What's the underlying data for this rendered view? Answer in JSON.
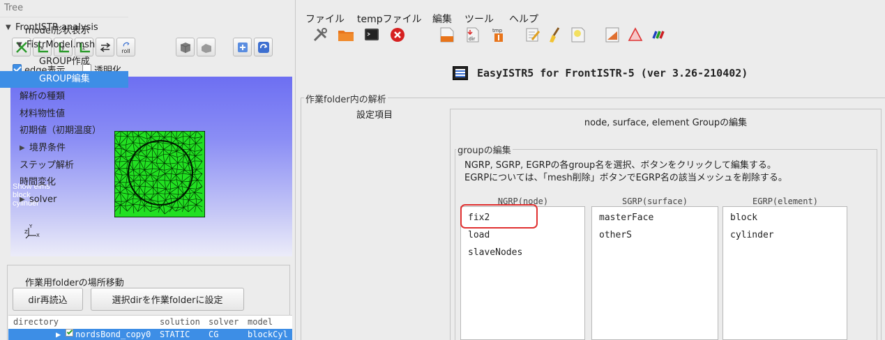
{
  "left": {
    "model_view_title": "model形状表示",
    "toolbar": {
      "roll_label": "roll",
      "x_label": "x",
      "y_label": "y",
      "z_label": "z"
    },
    "edge_display": {
      "label": "edge表示",
      "checked": true
    },
    "transparent": {
      "label": "透明化",
      "checked": false
    },
    "overlay": {
      "line1": "Show elms",
      "line2": "block",
      "line3": "cylinder"
    },
    "axes": {
      "y": "Y",
      "z": "Z",
      "x": "X"
    },
    "workdir": {
      "title": "作業用folderの場所移動",
      "reload_button": "dir再読込",
      "set_button": "選択dirを作業folderに設定"
    },
    "table": {
      "headers": [
        "directory",
        "solution",
        "solver",
        "model"
      ],
      "row": {
        "directory": "nordsBond_copy0",
        "solution": "STATIC",
        "solver": "CG",
        "model": "blockCyl"
      }
    }
  },
  "menu": [
    "ファイル",
    "tempファイル",
    "編集",
    "ツール",
    "ヘルプ"
  ],
  "toolbar_icons": [
    "tools-icon",
    "folder-icon",
    "terminal-icon",
    "close-icon",
    "file-icon",
    "dir-icon",
    "tmp-icon",
    "edit-icon",
    "brush-icon",
    "note-icon",
    "chart-icon",
    "triangle-icon",
    "color-bars-icon"
  ],
  "toolbar_text": {
    "dir": "dir",
    "tmp": "tmp"
  },
  "app_title": "EasyISTR5 for FrontISTR-5  (ver 3.26-210402)",
  "analysis": {
    "title": "作業folder内の解析",
    "settings_label": "設定項目",
    "tree_header": "Tree",
    "tree": [
      {
        "label": "FrontISTR analysis",
        "arrow": "▼"
      },
      {
        "label": "FistrModel.msh",
        "arrow": "▼"
      },
      {
        "label": "GROUP作成",
        "arrow": ""
      },
      {
        "label": "GROUP編集",
        "arrow": ""
      },
      {
        "label": "解析の種類",
        "arrow": ""
      },
      {
        "label": "材料物性値",
        "arrow": ""
      },
      {
        "label": "初期値（初期温度）",
        "arrow": ""
      },
      {
        "label": "境界条件",
        "arrow": "▶"
      },
      {
        "label": "ステップ解析",
        "arrow": ""
      },
      {
        "label": "時間変化",
        "arrow": ""
      },
      {
        "label": "solver",
        "arrow": "▶"
      }
    ]
  },
  "group_panel": {
    "title": "node, surface, element Groupの編集",
    "edit_legend": "groupの編集",
    "desc1": "NGRP, SGRP, EGRPの各group名を選択、ボタンをクリックして編集する。",
    "desc2": "EGRPについては、「mesh削除」ボタンでEGRP名の該当メッシュを削除する。",
    "ngrp": {
      "header": "NGRP(node)",
      "items": [
        "fix2",
        "load",
        "slaveNodes"
      ]
    },
    "sgrp": {
      "header": "SGRP(surface)",
      "items": [
        "masterFace",
        "otherS"
      ]
    },
    "egrp": {
      "header": "EGRP(element)",
      "items": [
        "block",
        "cylinder"
      ]
    }
  },
  "colors": {
    "selection": "#3d8ee6",
    "highlight": "#e03030",
    "mesh_fill": "#22e022",
    "viewport_top": "#6d6ff2"
  }
}
